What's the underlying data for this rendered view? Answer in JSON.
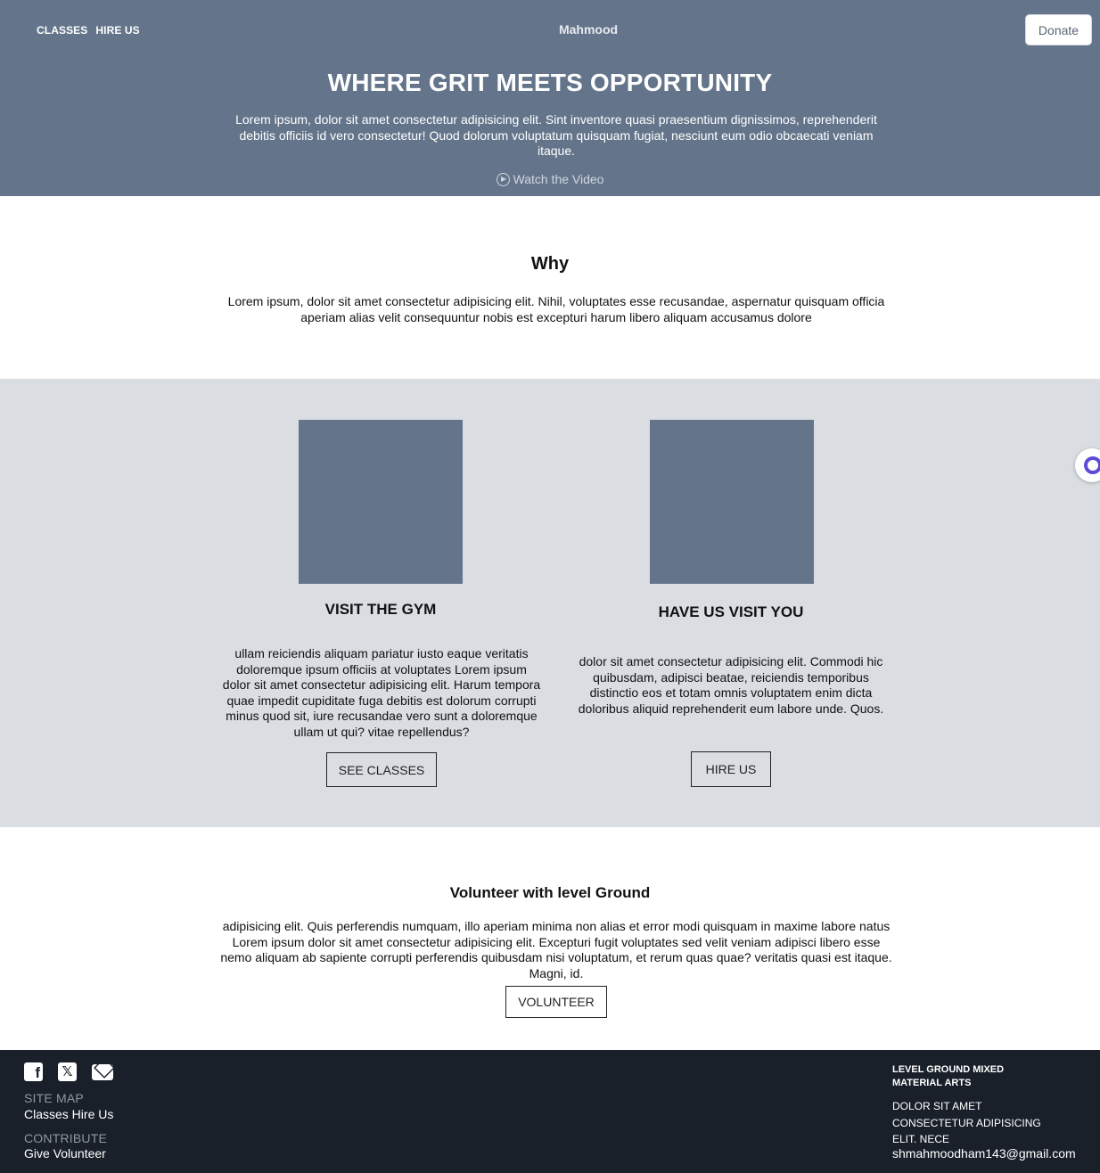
{
  "header": {
    "nav": [
      "CLASSES",
      "HIRE US"
    ],
    "brand": "Mahmood",
    "donate_label": "Donate"
  },
  "hero": {
    "title": "WHERE GRIT MEETS OPPORTUNITY",
    "text": "Lorem ipsum, dolor sit amet consectetur adipisicing elit. Sint inventore quasi praesentium dignissimos, reprehenderit debitis officiis id vero consectetur! Quod dolorum voluptatum quisquam fugiat, nesciunt eum odio obcaecati veniam itaque.",
    "watch_label": "Watch the Video"
  },
  "why": {
    "title": "Why",
    "text": "Lorem ipsum, dolor sit amet consectetur adipisicing elit. Nihil, voluptates esse recusandae, aspernatur quisquam officia aperiam alias velit consequuntur nobis est excepturi harum libero aliquam accusamus dolore"
  },
  "cards": [
    {
      "title": "VISIT THE GYM",
      "text": "ullam reiciendis aliquam pariatur iusto eaque veritatis doloremque ipsum officiis at voluptates Lorem ipsum dolor sit amet consectetur adipisicing elit. Harum tempora quae impedit cupiditate fuga debitis est dolorum corrupti minus quod sit, iure recusandae vero sunt a doloremque ullam ut qui? vitae repellendus?",
      "button": "SEE CLASSES"
    },
    {
      "title": "HAVE US VISIT YOU",
      "text": "dolor sit amet consectetur adipisicing elit. Commodi hic quibusdam, adipisci beatae, reiciendis temporibus distinctio eos et totam omnis voluptatem enim dicta doloribus aliquid reprehenderit eum labore unde. Quos.",
      "button": "HIRE US"
    }
  ],
  "volunteer": {
    "title": "Volunteer with level Ground",
    "text": "adipisicing elit. Quis perferendis numquam, illo aperiam minima non alias et error modi quisquam in maxime labore natus Lorem ipsum dolor sit amet consectetur adipisicing elit. Excepturi fugit voluptates sed velit veniam adipisci libero esse nemo aliquam ab sapiente corrupti perferendis quibusdam nisi voluptatum, et rerum quas quae? veritatis quasi est itaque. Magni, id.",
    "button": "VOLUNTEER"
  },
  "footer": {
    "social": [
      {
        "icon": "facebook-icon",
        "glyph": "f"
      },
      {
        "icon": "x-twitter-icon",
        "glyph": "𝕏"
      },
      {
        "icon": "envelope-icon",
        "glyph": ""
      }
    ],
    "sitemap_label": "SITE MAP",
    "sitemap_links": "Classes Hire Us",
    "contribute_label": "CONTRIBUTE",
    "contribute_links": "Give Volunteer",
    "org_name": "LEVEL GROUND MIXED MATERIAL ARTS",
    "address": "DOLOR SIT AMET CONSECTETUR ADIPISICING ELIT. NECE",
    "email": "shmahmoodham143@gmail.com"
  },
  "colors": {
    "hero_bg": "#64758b",
    "section_bg": "#dadde2",
    "footer_bg": "#1a202a",
    "chat_accent": "#5b4bd8"
  }
}
